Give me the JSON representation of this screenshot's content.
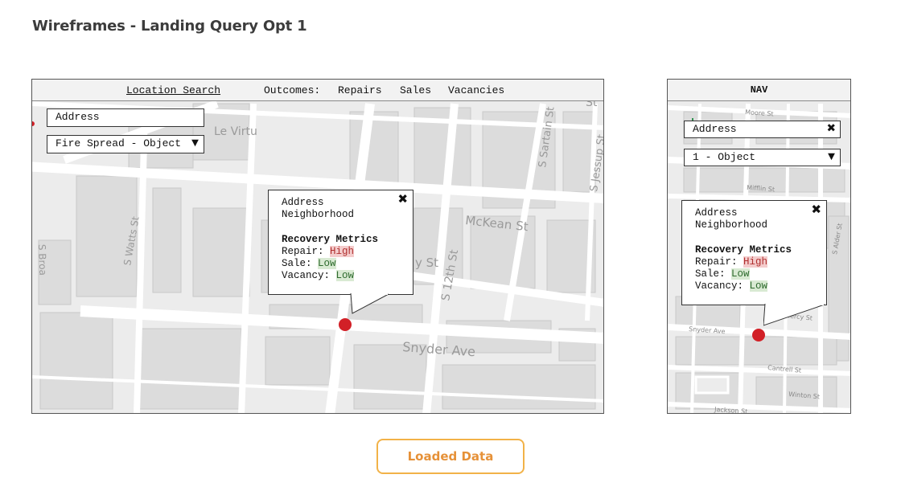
{
  "page": {
    "title": "Wireframes - Landing Query Opt 1"
  },
  "desktop": {
    "nav": {
      "location_search": "Location Search",
      "outcomes_label": "Outcomes:",
      "repairs": "Repairs",
      "sales": "Sales",
      "vacancies": "Vacancies"
    },
    "address_input": {
      "value": "Address"
    },
    "filter_select": {
      "value": "Fire Spread - Object"
    },
    "map_labels": {
      "le_virtu": "Le Virtu",
      "mckean": "McKean St",
      "snyder": "Snyder Ave",
      "s_watts": "S Watts St",
      "s_sartain": "S Sartain St",
      "s_jessup": "S Jessup St",
      "s_12th": "S 12th St",
      "st_fragment": "St",
      "st_fragment_2": "y St",
      "left_fragment": "S Broa"
    },
    "popup": {
      "address": "Address",
      "neighborhood": "Neighborhood",
      "metrics_title": "Recovery Metrics",
      "repair_label": "Repair:",
      "repair_value": "High",
      "sale_label": "Sale:",
      "sale_value": "Low",
      "vacancy_label": "Vacancy:",
      "vacancy_value": "Low",
      "close": "✖"
    }
  },
  "mobile": {
    "nav": {
      "title": "NAV"
    },
    "address_input": {
      "value": "Address",
      "clear": "✖"
    },
    "filter_select": {
      "value": "1 - Object"
    },
    "map_labels": {
      "moore": "Moore St",
      "mifflin": "Mifflin St",
      "snyder": "Snyder Ave",
      "mercy": "Mercy St",
      "cantrell": "Cantrell St",
      "winton": "Winton St",
      "jackson": "Jackson St",
      "s_alder": "S Alder St"
    },
    "popup": {
      "address": "Address",
      "neighborhood": "Neighborhood",
      "metrics_title": "Recovery Metrics",
      "repair_label": "Repair:",
      "repair_value": "High",
      "sale_label": "Sale:",
      "sale_value": "Low",
      "vacancy_label": "Vacancy:",
      "vacancy_value": "Low",
      "close": "✖"
    }
  },
  "footer": {
    "loaded_button": "Loaded Data"
  },
  "colors": {
    "pin": "#d22027",
    "accent_orange": "#e69138",
    "high_bg": "#f4cccc",
    "low_bg": "#d9ead3"
  },
  "icons": {
    "dropdown": "triangle-down-icon",
    "close": "close-icon",
    "pin": "map-pin-icon"
  }
}
